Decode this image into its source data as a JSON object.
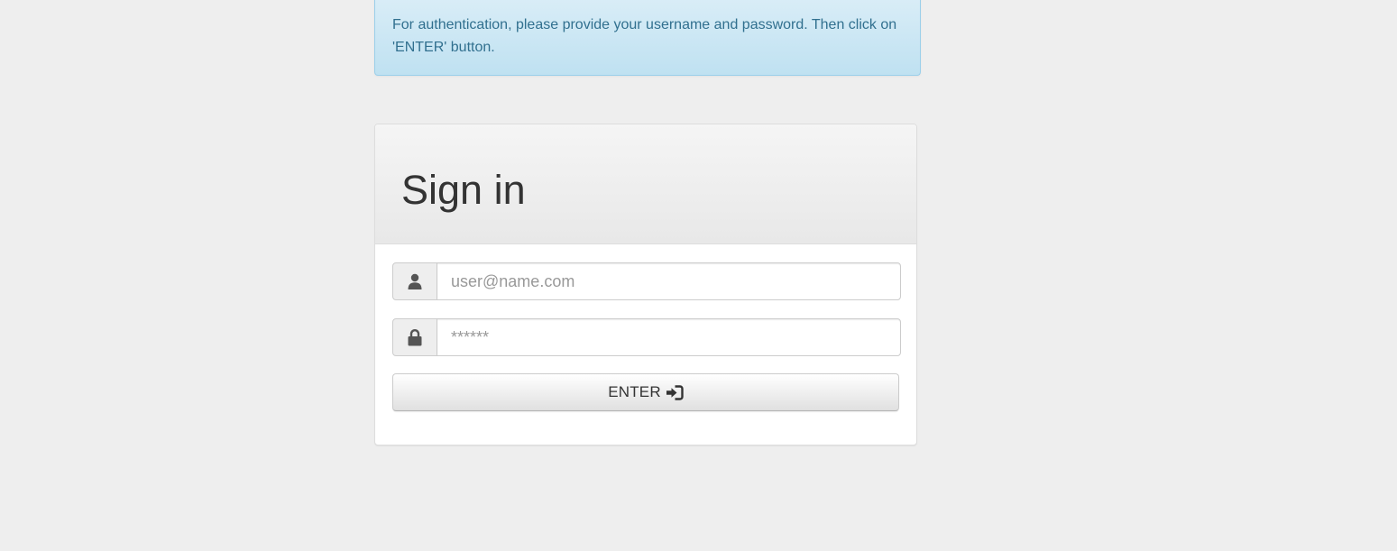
{
  "alert": {
    "message": "For authentication, please provide your username and password. Then click on 'ENTER' button."
  },
  "login_panel": {
    "title": "Sign in",
    "username": {
      "icon": "user-icon",
      "placeholder": "user@name.com",
      "value": ""
    },
    "password": {
      "icon": "lock-icon",
      "placeholder": "******",
      "value": ""
    },
    "submit": {
      "label": "ENTER",
      "icon": "sign-in-icon"
    }
  },
  "colors": {
    "background": "#eeeeee",
    "alert_text": "#31708f",
    "alert_bg": "#d9edf7",
    "panel_border": "#dddddd",
    "title_text": "#333333"
  }
}
